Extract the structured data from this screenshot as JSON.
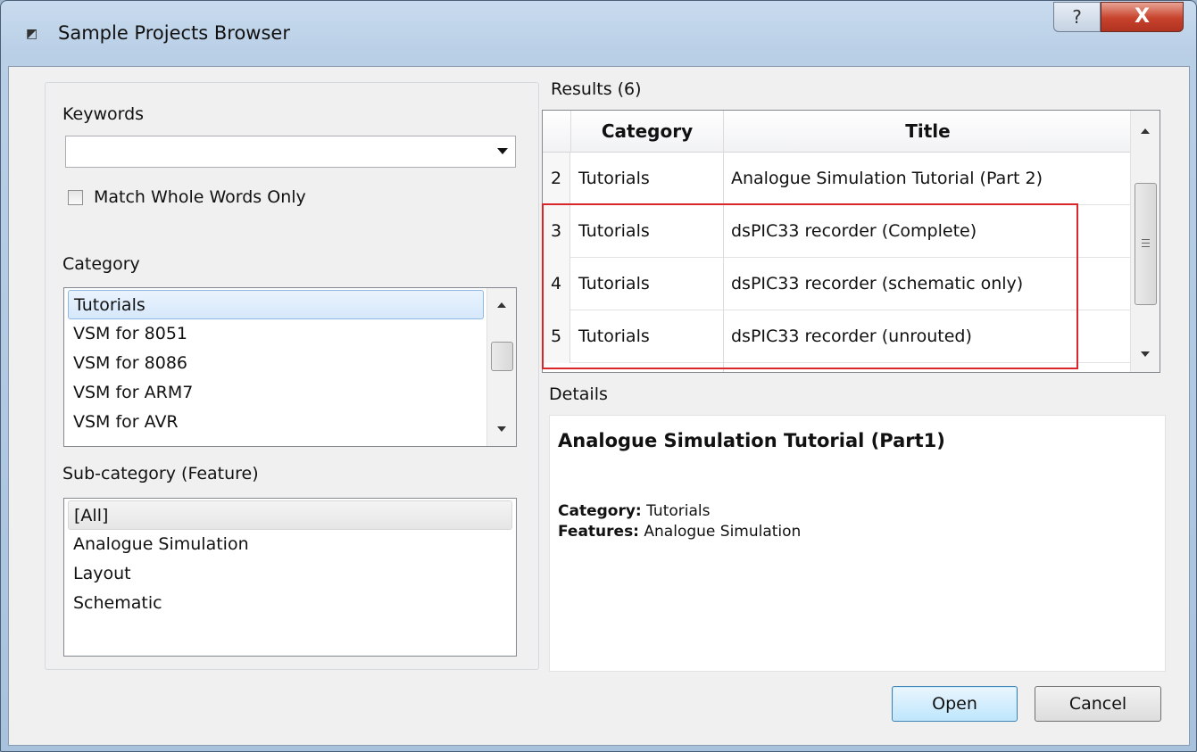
{
  "window": {
    "title": "Sample Projects Browser",
    "help_label": "?",
    "close_label": "X"
  },
  "filters": {
    "keywords_label": "Keywords",
    "keywords_value": "",
    "match_whole_words_label": "Match Whole Words Only",
    "match_whole_words_checked": false,
    "category_label": "Category",
    "category_items": [
      "Tutorials",
      "VSM for 8051",
      "VSM for 8086",
      "VSM for ARM7",
      "VSM for AVR"
    ],
    "category_selected": "Tutorials",
    "subcategory_label": "Sub-category (Feature)",
    "subcategory_items": [
      "[All]",
      "Analogue Simulation",
      "Layout",
      "Schematic"
    ],
    "subcategory_selected": "[All]"
  },
  "results": {
    "label": "Results (6)",
    "columns": [
      "Category",
      "Title"
    ],
    "rows": [
      {
        "num": "2",
        "category": "Tutorials",
        "title": "Analogue Simulation Tutorial (Part 2)"
      },
      {
        "num": "3",
        "category": "Tutorials",
        "title": "dsPIC33 recorder (Complete)"
      },
      {
        "num": "4",
        "category": "Tutorials",
        "title": "dsPIC33 recorder (schematic only)"
      },
      {
        "num": "5",
        "category": "Tutorials",
        "title": "dsPIC33 recorder (unrouted)"
      }
    ],
    "highlight_color": "#d9262b"
  },
  "details": {
    "label": "Details",
    "heading": "Analogue Simulation Tutorial (Part1)",
    "category_key": "Category:",
    "category_value": "Tutorials",
    "features_key": "Features:",
    "features_value": "Analogue Simulation"
  },
  "buttons": {
    "open": "Open",
    "cancel": "Cancel"
  }
}
